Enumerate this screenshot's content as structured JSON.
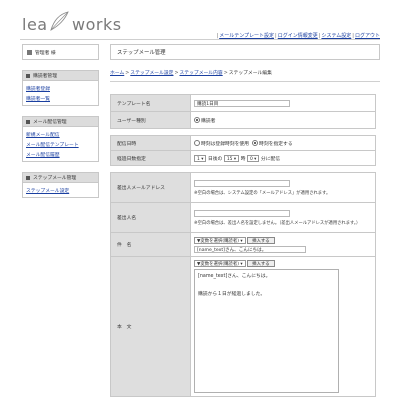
{
  "brand": {
    "part1": "lea",
    "part2": "works"
  },
  "top_links": [
    "メールテンプレート設定",
    "ログイン情報変更",
    "システム設定",
    "ログアウト"
  ],
  "sidebar": {
    "user": "管理者 様",
    "sections": [
      {
        "title": "購読者管理",
        "links": [
          "購読者登録",
          "購読者一覧"
        ]
      },
      {
        "title": "メール配信管理",
        "links": [
          "新規メール配信",
          "メール配信テンプレート",
          "メール配信履歴"
        ]
      },
      {
        "title": "ステップメール管理",
        "links": [
          "ステップメール設定"
        ]
      }
    ]
  },
  "main": {
    "page_title": "ステップメール管理",
    "breadcrumb": [
      "ホーム",
      "ステップメール設定",
      "ステップメール内容",
      "ステップメール編集"
    ],
    "template_name_label": "テンプレート名",
    "template_name_value": "購読1日目",
    "user_type_label": "ユーザー種別",
    "user_type_option": "購読者",
    "send_date_label": "配信日時",
    "send_date_opt1": "時刻は登録時刻を使用",
    "send_date_opt2": "時刻を指定する",
    "send_schedule_label": "経過日数指定",
    "sched_day": "1",
    "sched_day_unit": "日後の",
    "sched_hour": "15",
    "sched_hour_unit": "時",
    "sched_min": "0",
    "sched_min_unit": "分に配信",
    "from_email_label": "差出人メールアドレス",
    "from_email_note": "※空白の場合は、システム設定の「メールアドレス」が適用されます。",
    "from_name_label": "差出人名",
    "from_name_note": "※空白の場合は、差出人名を設定しません。（差出人メールアドレスが適用されます。）",
    "subject_label": "件　名",
    "subject_select": "▼変数を選択(購読者)",
    "subject_insert": "挿入する",
    "subject_value": "[name_text]さん、こんにちは。",
    "body_label": "本　文",
    "body_select": "▼変数を選択(購読者)",
    "body_insert": "挿入する",
    "body_lines": [
      "[name_text]さん、こんにちは。",
      "",
      "購読から１日が経過しました。"
    ]
  }
}
